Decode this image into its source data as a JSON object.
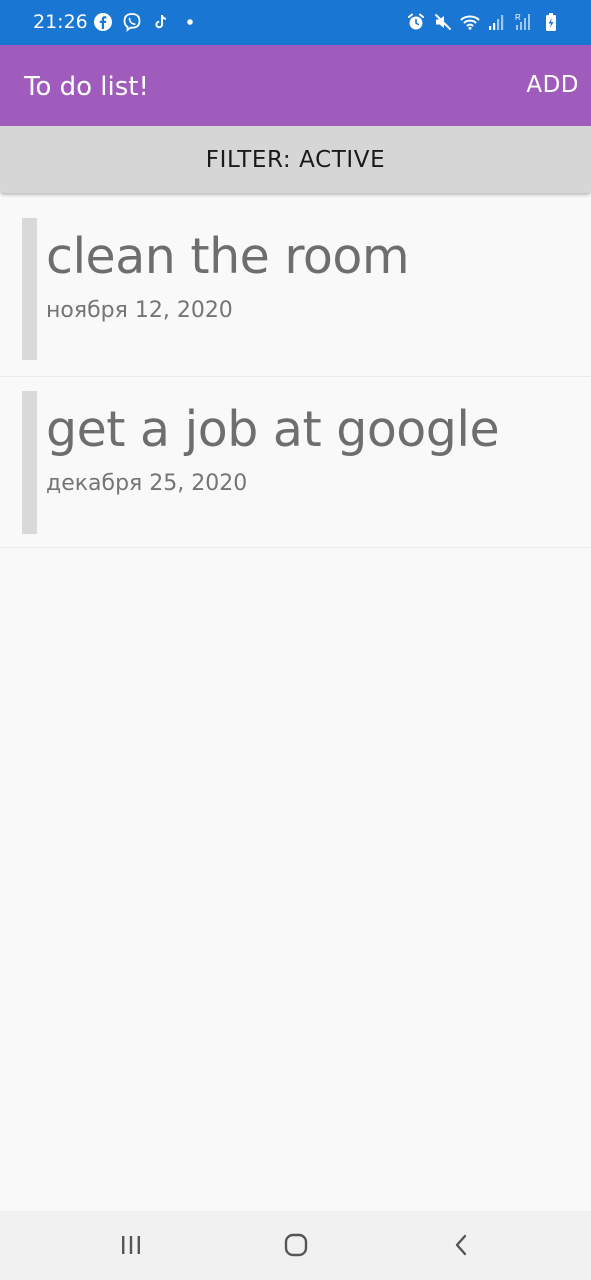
{
  "status_bar": {
    "time": "21:26",
    "left_icons": [
      "facebook-icon",
      "viber-icon",
      "tiktok-icon",
      "dot-icon"
    ],
    "right_icons": [
      "alarm-icon",
      "mute-icon",
      "wifi-icon",
      "signal-icon",
      "signal-roaming-icon",
      "battery-charging-icon"
    ],
    "background": "#1976d2"
  },
  "app_bar": {
    "title": "To do list!",
    "add_label": "ADD",
    "background": "#a05cbd"
  },
  "filter": {
    "label": "FILTER: ACTIVE"
  },
  "tasks": [
    {
      "title": "clean the room",
      "date": "ноября 12, 2020"
    },
    {
      "title": "get a job at google",
      "date": "декабря 25, 2020"
    }
  ],
  "nav_bar": {
    "buttons": [
      "recents-icon",
      "home-icon",
      "back-icon"
    ]
  }
}
